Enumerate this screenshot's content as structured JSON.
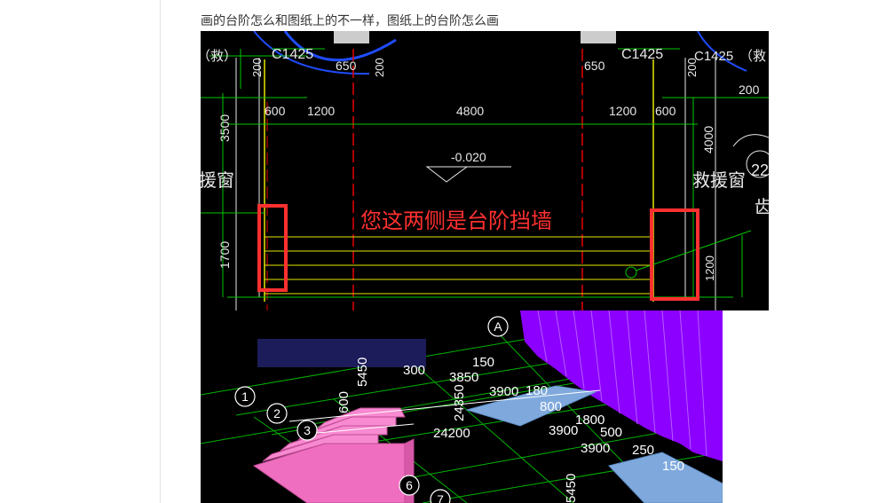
{
  "post": {
    "question": "画的台阶怎么和图纸上的不一样，图纸上的台阶怎么画"
  },
  "cad_drawing": {
    "annotation": "您这两侧是台阶挡墙",
    "labels": {
      "window_left": "C1425",
      "window_right": "C1425",
      "jiu_left": "（救）",
      "jiu_right": "（救",
      "dim_200_a": "200",
      "dim_200_b": "200",
      "dim_200_c": "200",
      "dim_200_right": "200",
      "dim_650_left": "650",
      "dim_650_right": "650",
      "dim_600_left": "600",
      "dim_1200_left": "1200",
      "dim_4800": "4800",
      "dim_1200_right": "1200",
      "dim_600_right": "600",
      "dim_3500": "3500",
      "dim_4000": "4000",
      "dim_1700": "1700",
      "dim_1200_vert": "1200",
      "elevation": "-0.020",
      "rescue_window_left": "援窗",
      "rescue_window_right": "救援窗",
      "right_edge_text": "22",
      "right_edge_char": "齿"
    }
  },
  "model_3d": {
    "axis_markers": [
      "A",
      "1",
      "2",
      "3",
      "6",
      "7"
    ],
    "labels": {
      "v5450_a": "5450",
      "v5450_b": "5450",
      "v24350": "24350",
      "v300": "300",
      "v600": "600",
      "v150_a": "150",
      "v150_b": "150",
      "v3850": "3850",
      "v3900_a": "3900",
      "v3900_b": "3900",
      "v3900_c": "3900",
      "v180": "180",
      "v800": "800",
      "v1800": "1800",
      "v500": "500",
      "v24200": "24200",
      "v250": "250"
    },
    "colors": {
      "stairs": "#f06ec0",
      "walls": "#8c00ff",
      "slab": "#7fa9dd",
      "grid": "#00b400",
      "tooltip": "#1c1c5a"
    }
  }
}
